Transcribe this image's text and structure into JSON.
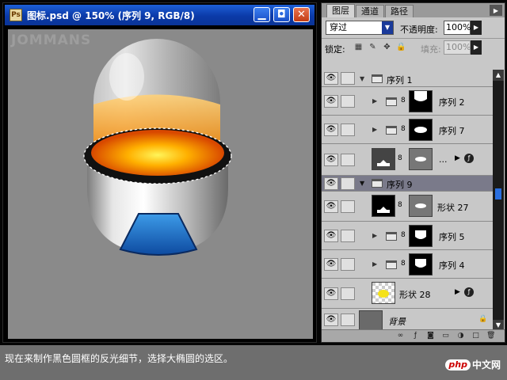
{
  "document": {
    "title": "图标.psd @ 150% (序列 9, RGB/8)",
    "icon": "ps-doc-icon",
    "watermark": "JOMMANS",
    "buttons": {
      "minimize": "▁",
      "restore": "◘",
      "close": "✕"
    }
  },
  "layers_panel": {
    "tabs": [
      "图层",
      "通道",
      "路径"
    ],
    "blend_mode": "穿过",
    "opacity_label": "不透明度:",
    "opacity_value": "100%",
    "lock_label": "锁定:",
    "fill_label": "填充:",
    "fill_value": "100%",
    "layers": [
      {
        "name": "序列 1",
        "type": "group",
        "expanded": true
      },
      {
        "name": "序列 2",
        "type": "group-masked",
        "expanded": false
      },
      {
        "name": "序列 7",
        "type": "group-masked",
        "expanded": false
      },
      {
        "name": "...",
        "type": "adjustment-layer"
      },
      {
        "name": "序列 9",
        "type": "group",
        "expanded": true,
        "selected": true
      },
      {
        "name": "形状 27",
        "type": "shape-masked"
      },
      {
        "name": "序列 5",
        "type": "group-masked",
        "expanded": false
      },
      {
        "name": "序列 4",
        "type": "group-masked",
        "expanded": false
      },
      {
        "name": "形状 28",
        "type": "shape"
      },
      {
        "name": "背景",
        "type": "background",
        "locked": true
      }
    ]
  },
  "caption": "现在来制作黑色圆框的反光细节，选择大椭圆的选区。",
  "site_watermark": {
    "badge": "php",
    "text": "中文网"
  },
  "colors": {
    "title_bar": "#0b3aa8",
    "canvas_bg": "#8a8a8a",
    "orange_liquid": "#f7a21a",
    "blue_window": "#1a64c8"
  }
}
